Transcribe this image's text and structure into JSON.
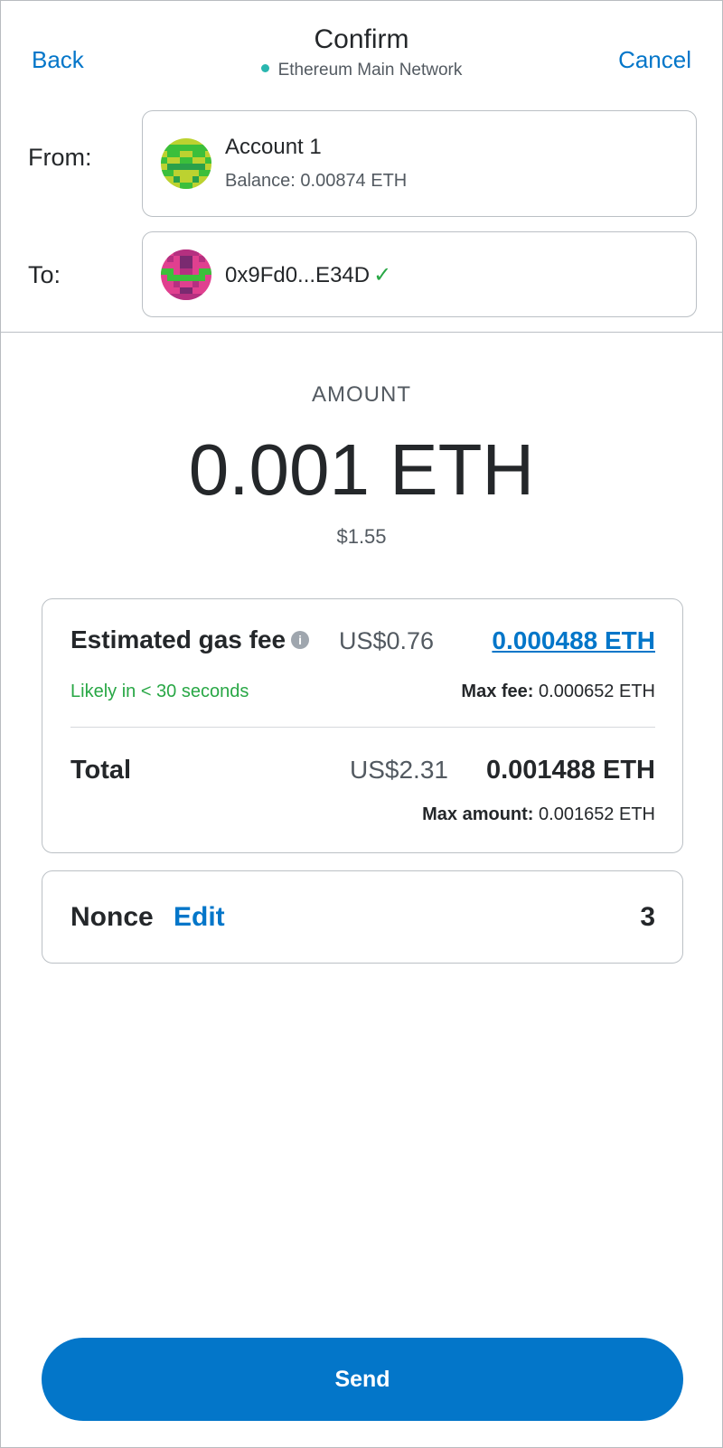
{
  "header": {
    "back_label": "Back",
    "title": "Confirm",
    "network": "Ethereum Main Network",
    "cancel_label": "Cancel"
  },
  "from": {
    "label": "From:",
    "account_name": "Account 1",
    "balance": "Balance: 0.00874 ETH"
  },
  "to": {
    "label": "To:",
    "address": "0x9Fd0...E34D",
    "verified_icon": "checkmark-icon"
  },
  "amount": {
    "label": "AMOUNT",
    "value": "0.001 ETH",
    "fiat": "$1.55"
  },
  "gas": {
    "title": "Estimated gas fee",
    "info_icon": "info-icon",
    "fee_usd": "US$0.76",
    "fee_eth": "0.000488 ETH",
    "likely": "Likely in < 30 seconds",
    "max_fee_label": "Max fee:",
    "max_fee_value": "0.000652 ETH",
    "total_label": "Total",
    "total_usd": "US$2.31",
    "total_eth": "0.001488 ETH",
    "max_amount_label": "Max amount:",
    "max_amount_value": "0.001652 ETH"
  },
  "nonce": {
    "label": "Nonce",
    "edit_label": "Edit",
    "value": "3"
  },
  "send_label": "Send",
  "colors": {
    "accent": "#0376c9",
    "success": "#28a745",
    "network_dot": "#29b6af"
  }
}
